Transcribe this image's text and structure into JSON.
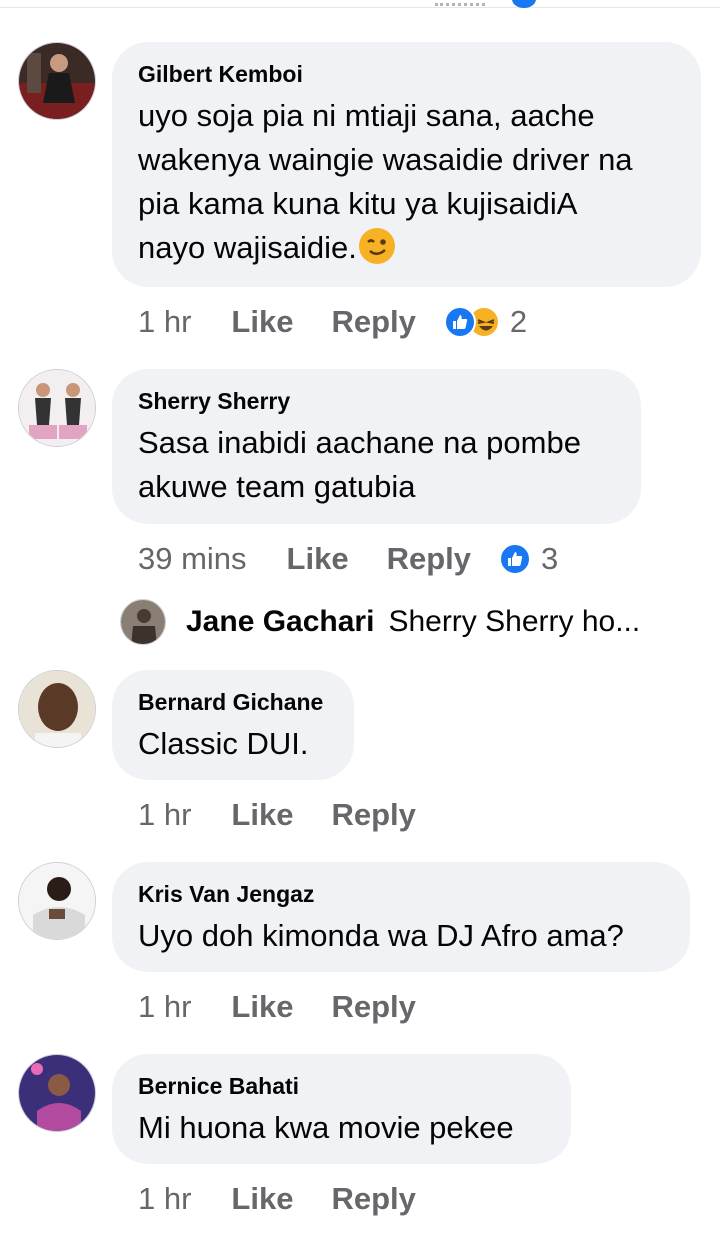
{
  "comments": [
    {
      "author": "Gilbert Kemboi",
      "lines": [
        "uyo soja pia ni mtiaji sana, aache",
        "wakenya waingie wasaidie driver na",
        "pia kama kuna kitu ya kujisaidiA",
        "nayo wajisaidie."
      ],
      "time": "1 hr",
      "like": "Like",
      "reply": "Reply",
      "reaction_count": "2",
      "reactions": [
        "like-icon",
        "haha-icon"
      ]
    },
    {
      "author": "Sherry Sherry",
      "lines": [
        "Sasa inabidi aachane na pombe",
        "akuwe team gatubia"
      ],
      "time": "39 mins",
      "like": "Like",
      "reply": "Reply",
      "reaction_count": "3",
      "reactions": [
        "like-icon"
      ]
    },
    {
      "author": "Bernard Gichane",
      "lines": [
        "Classic DUI."
      ],
      "time": "1 hr",
      "like": "Like",
      "reply": "Reply"
    },
    {
      "author": "Kris Van Jengaz",
      "lines": [
        "Uyo doh kimonda wa DJ Afro ama?"
      ],
      "time": "1 hr",
      "like": "Like",
      "reply": "Reply"
    },
    {
      "author": "Bernice Bahati",
      "lines": [
        "Mi huona kwa movie pekee"
      ],
      "time": "1 hr",
      "like": "Like",
      "reply": "Reply"
    }
  ],
  "reply_preview": {
    "author": "Jane Gachari",
    "text": "Sherry Sherry ho..."
  },
  "colors": {
    "bubble": "#f0f2f5",
    "meta": "#65676b",
    "like_blue": "#1877f2",
    "emoji_yellow": "#f7b125"
  }
}
